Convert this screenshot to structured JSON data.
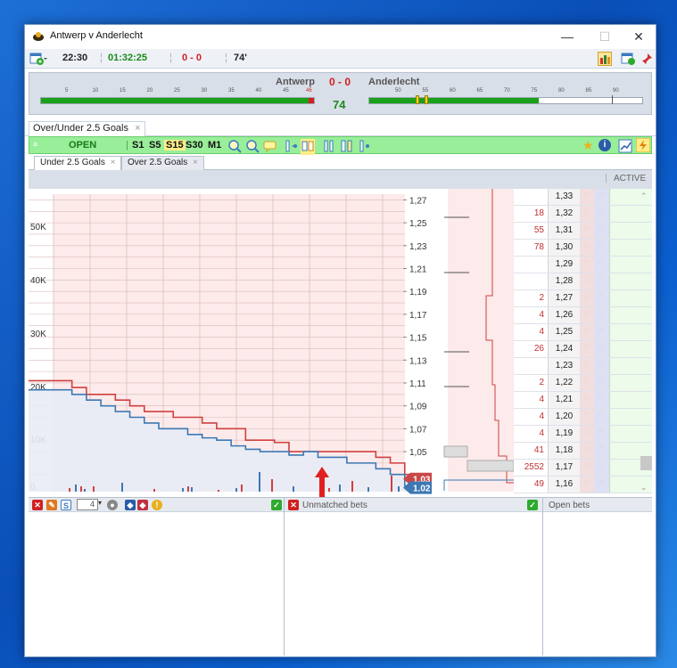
{
  "window": {
    "title": "Antwerp v Anderlecht",
    "min": "—",
    "max": "☐",
    "close": "✕"
  },
  "toolbar": {
    "time": "22:30",
    "elapsed": "01:32:25",
    "score": "0 - 0",
    "minute": "74'"
  },
  "scoreboard": {
    "home": "Antwerp",
    "away": "Anderlecht",
    "score": "0 - 0",
    "minute": "74",
    "home_ticks": [
      "5",
      "10",
      "15",
      "20",
      "25",
      "30",
      "35",
      "40",
      "45",
      "46"
    ],
    "away_ticks": [
      "50",
      "55",
      "60",
      "65",
      "70",
      "75",
      "80",
      "85",
      "90"
    ],
    "home_progress": 1.0,
    "away_progress": 0.62
  },
  "tabs": {
    "main": "Over/Under 2.5 Goals",
    "close": "×"
  },
  "market": {
    "status": "OPEN",
    "intervals": [
      "S1",
      "S5",
      "S15",
      "S30",
      "M1"
    ]
  },
  "subtabs": {
    "first": "Under 2.5 Goals",
    "second": "Over 2.5 Goals",
    "close": "×"
  },
  "status": {
    "active": "ACTIVE"
  },
  "chart_data": {
    "type": "line",
    "ylabel_left": "",
    "y_left_ticks": [
      "50K",
      "40K",
      "30K",
      "20K",
      "10K",
      "0"
    ],
    "y_right_ticks": [
      "1,27",
      "1,25",
      "1,23",
      "1,21",
      "1,19",
      "1,17",
      "1,15",
      "1,13",
      "1,11",
      "1,09",
      "1,07",
      "1,05"
    ],
    "series": [
      {
        "name": "",
        "color": "#d04040",
        "values": [
          1.112,
          1.112,
          1.112,
          1.106,
          1.1,
          1.1,
          1.095,
          1.09,
          1.085,
          1.085,
          1.08,
          1.08,
          1.075,
          1.07,
          1.07,
          1.06,
          1.06,
          1.058,
          1.05,
          1.05,
          1.05,
          1.05,
          1.05,
          1.05,
          1.045,
          1.04,
          1.03,
          1.03
        ]
      },
      {
        "name": "",
        "color": "#3c78b4",
        "values": [
          1.104,
          1.104,
          1.104,
          1.1,
          1.095,
          1.09,
          1.085,
          1.08,
          1.075,
          1.07,
          1.07,
          1.065,
          1.062,
          1.06,
          1.055,
          1.052,
          1.05,
          1.05,
          1.047,
          1.05,
          1.045,
          1.045,
          1.04,
          1.04,
          1.035,
          1.03,
          1.02,
          1.02
        ]
      }
    ],
    "last_red": "1.03",
    "last_blue": "1.02"
  },
  "ladder": {
    "rows": [
      {
        "price": "1,33",
        "vol": ""
      },
      {
        "price": "1,32",
        "vol": "18"
      },
      {
        "price": "1,31",
        "vol": "55"
      },
      {
        "price": "1,30",
        "vol": "78"
      },
      {
        "price": "1,29",
        "vol": ""
      },
      {
        "price": "1,28",
        "vol": ""
      },
      {
        "price": "1,27",
        "vol": "2"
      },
      {
        "price": "1,26",
        "vol": "4"
      },
      {
        "price": "1,25",
        "vol": "4"
      },
      {
        "price": "1,24",
        "vol": "26"
      },
      {
        "price": "1,23",
        "vol": ""
      },
      {
        "price": "1,22",
        "vol": "2"
      },
      {
        "price": "1,21",
        "vol": "4"
      },
      {
        "price": "1,20",
        "vol": "4"
      },
      {
        "price": "1,19",
        "vol": "4"
      },
      {
        "price": "1,18",
        "vol": "41"
      },
      {
        "price": "1,17",
        "vol": "2552"
      },
      {
        "price": "1,16",
        "vol": "49"
      }
    ]
  },
  "bottom": {
    "stake": "4",
    "unmatched": "Unmatched bets",
    "open": "Open bets"
  }
}
